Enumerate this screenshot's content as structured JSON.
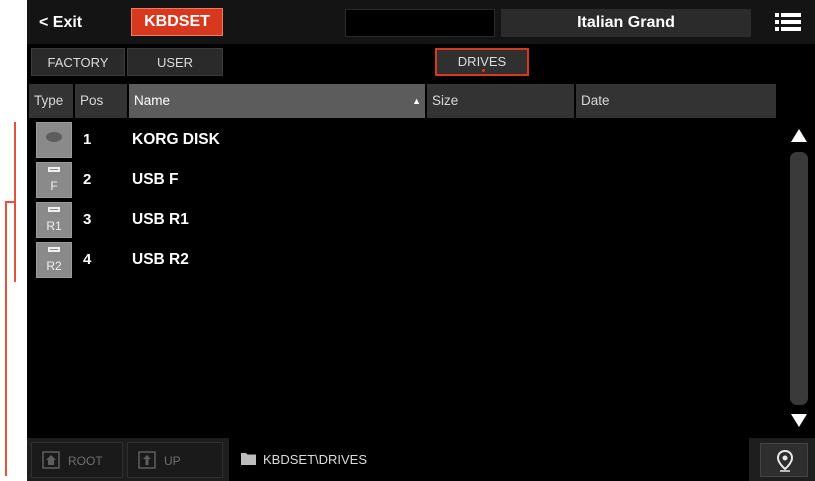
{
  "topbar": {
    "exit_label": "< Exit",
    "mode_label": "KBDSET",
    "sound_name": "Italian Grand"
  },
  "tabs": {
    "factory": "FACTORY",
    "user": "USER",
    "drives": "DRIVES"
  },
  "columns": {
    "type": "Type",
    "pos": "Pos",
    "name": "Name",
    "size": "Size",
    "date": "Date"
  },
  "rows": [
    {
      "pos": "1",
      "name": "KORG DISK",
      "icon": "disk-icon"
    },
    {
      "pos": "2",
      "name": "USB F",
      "icon": "usb-icon",
      "badge": "F"
    },
    {
      "pos": "3",
      "name": "USB R1",
      "icon": "usb-icon",
      "badge": "R1"
    },
    {
      "pos": "4",
      "name": "USB R2",
      "icon": "usb-icon",
      "badge": "R2"
    }
  ],
  "bottom": {
    "root_label": "ROOT",
    "up_label": "UP",
    "path": "KBDSET\\DRIVES"
  },
  "colors": {
    "accent": "#d8391e",
    "background": "#000000",
    "annotation": "#e0533c"
  }
}
